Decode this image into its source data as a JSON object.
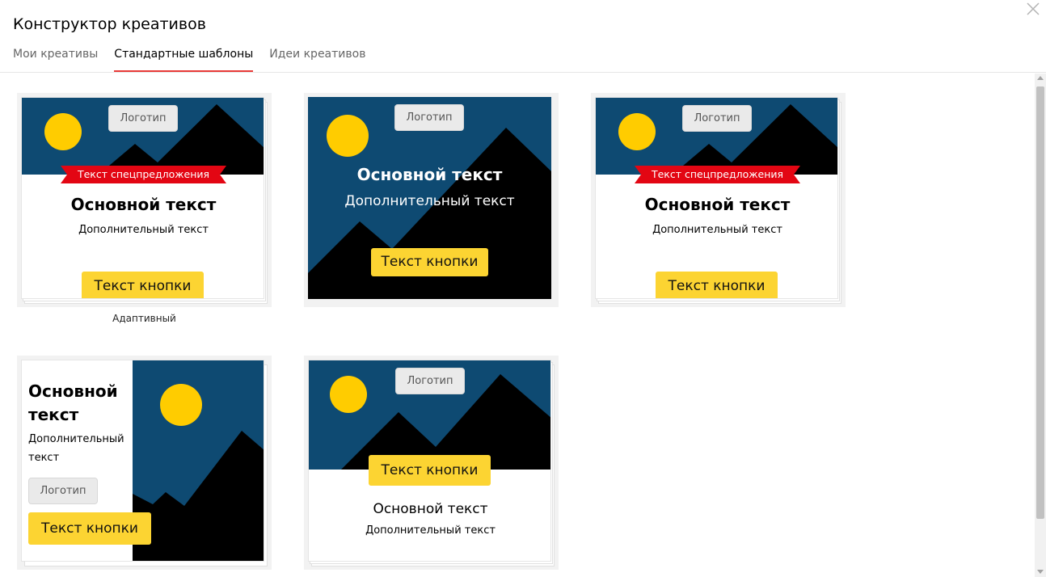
{
  "window": {
    "title": "Конструктор креативов",
    "close_icon": "close-icon"
  },
  "tabs": [
    {
      "label": "Мои креативы",
      "active": false
    },
    {
      "label": "Стандартные шаблоны",
      "active": true
    },
    {
      "label": "Идеи креативов",
      "active": false
    }
  ],
  "colors": {
    "accent": "#e83a38",
    "banner_blue": "#0e4a72",
    "sun": "#ffcc00",
    "button": "#fcd432",
    "ribbon": "#e30613"
  },
  "templates": [
    {
      "logo": "Логотип",
      "offer": "Текст спецпредложения",
      "main": "Основной текст",
      "sub": "Дополнительный текст",
      "button": "Текст кнопки",
      "caption": "Адаптивный"
    },
    {
      "logo": "Логотип",
      "main": "Основной текст",
      "sub": "Дополнительный текст",
      "button": "Текст кнопки"
    },
    {
      "logo": "Логотип",
      "offer": "Текст спецпредложения",
      "main": "Основной текст",
      "sub": "Дополнительный текст",
      "button": "Текст кнопки"
    },
    {
      "logo": "Логотип",
      "main_line1": "Основной",
      "main_line2": "текст",
      "sub_line1": "Дополнительный",
      "sub_line2": "текст",
      "button": "Текст кнопки"
    },
    {
      "logo": "Логотип",
      "main": "Основной текст",
      "sub": "Дополнительный текст",
      "button": "Текст кнопки"
    }
  ]
}
